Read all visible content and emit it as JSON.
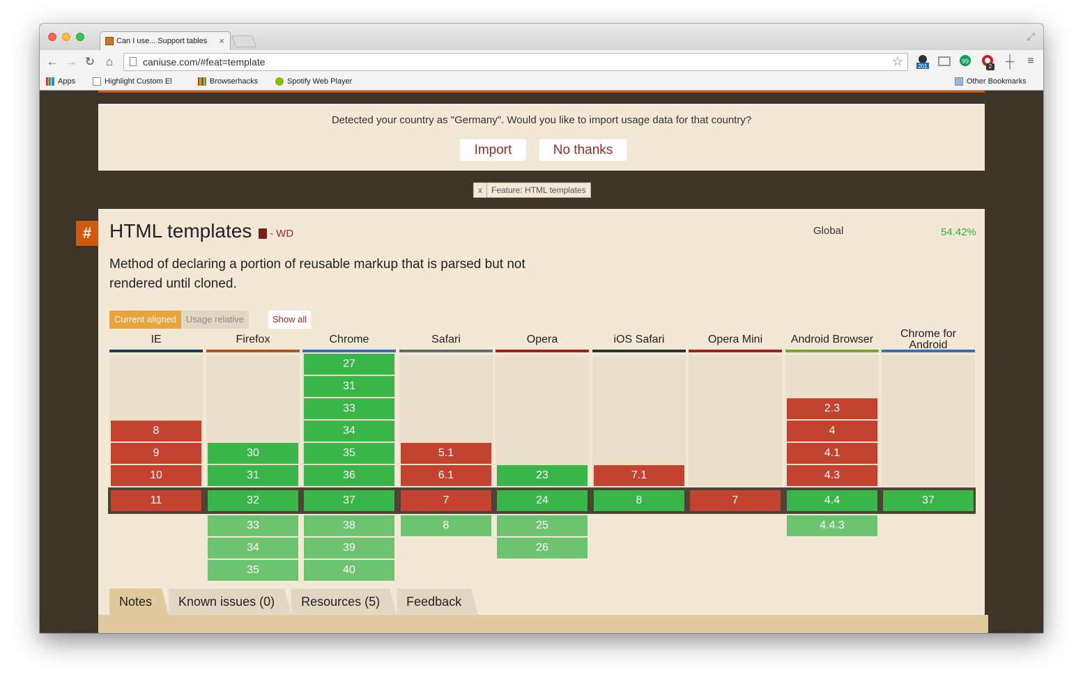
{
  "browser": {
    "tab_title": "Can I use... Support tables",
    "tab_close": "×",
    "url": "caniuse.com/#feat=template",
    "extensions": {
      "badge_1": "201",
      "badge_2": "2"
    },
    "bookmarks": [
      {
        "label": "Apps",
        "icon": "apps-grid-icon"
      },
      {
        "label": "Highlight Custom El",
        "icon": "page-icon"
      },
      {
        "label": "Browserhacks",
        "icon": "browserhacks-icon"
      },
      {
        "label": "Spotify Web Player",
        "icon": "spotify-icon"
      }
    ],
    "other_bookmarks": "Other Bookmarks"
  },
  "import_prompt": {
    "message": "Detected your country as \"Germany\". Would you like to import usage data for that country?",
    "import_label": "Import",
    "no_thanks_label": "No thanks"
  },
  "feature_chip": {
    "close": "x",
    "label": "Feature: HTML templates"
  },
  "feature": {
    "hash": "#",
    "title": "HTML templates",
    "status": "- WD",
    "global_label": "Global",
    "global_pct": "54.42%",
    "description": "Method of declaring a portion of reusable markup that is parsed but not rendered until cloned."
  },
  "view": {
    "current_aligned": "Current aligned",
    "usage_relative": "Usage relative",
    "show_all": "Show all"
  },
  "colors": {
    "no": "#c44230",
    "yes": "#39b54a",
    "future": "#6cc46f",
    "accent": "#d2580e"
  },
  "browsers": [
    {
      "name": "IE",
      "line": "#1f3a5f",
      "past": [
        {
          "v": "8",
          "s": "no"
        },
        {
          "v": "9",
          "s": "no"
        },
        {
          "v": "10",
          "s": "no"
        }
      ],
      "current": {
        "v": "11",
        "s": "no"
      },
      "future": []
    },
    {
      "name": "Firefox",
      "line": "#b5581f",
      "past": [
        {
          "v": "30",
          "s": "yes"
        },
        {
          "v": "31",
          "s": "yes"
        }
      ],
      "current": {
        "v": "32",
        "s": "yes"
      },
      "future": [
        "33",
        "34",
        "35"
      ]
    },
    {
      "name": "Chrome",
      "line": "#3a6fb5",
      "past": [
        {
          "v": "27",
          "s": "yes"
        },
        {
          "v": "31",
          "s": "yes"
        },
        {
          "v": "33",
          "s": "yes"
        },
        {
          "v": "34",
          "s": "yes"
        },
        {
          "v": "35",
          "s": "yes"
        },
        {
          "v": "36",
          "s": "yes"
        }
      ],
      "current": {
        "v": "37",
        "s": "yes"
      },
      "future": [
        "38",
        "39",
        "40"
      ]
    },
    {
      "name": "Safari",
      "line": "#6b6b6b",
      "past": [
        {
          "v": "5.1",
          "s": "no"
        },
        {
          "v": "6.1",
          "s": "no"
        }
      ],
      "current": {
        "v": "7",
        "s": "no"
      },
      "future": [
        "8"
      ]
    },
    {
      "name": "Opera",
      "line": "#a02020",
      "past": [
        {
          "v": "23",
          "s": "yes"
        }
      ],
      "current": {
        "v": "24",
        "s": "yes"
      },
      "future": [
        "25",
        "26"
      ]
    },
    {
      "name": "iOS Safari",
      "line": "#333333",
      "past": [
        {
          "v": "7.1",
          "s": "no"
        }
      ],
      "current": {
        "v": "8",
        "s": "yes"
      },
      "future": []
    },
    {
      "name": "Opera Mini",
      "line": "#a02020",
      "past": [],
      "current": {
        "v": "7",
        "s": "no"
      },
      "future": []
    },
    {
      "name": "Android Browser",
      "line": "#78a832",
      "past": [
        {
          "v": "2.3",
          "s": "no"
        },
        {
          "v": "4",
          "s": "no"
        },
        {
          "v": "4.1",
          "s": "no"
        },
        {
          "v": "4.3",
          "s": "no"
        }
      ],
      "current": {
        "v": "4.4",
        "s": "yes"
      },
      "future": [
        "4.4.3"
      ]
    },
    {
      "name": "Chrome for Android",
      "line": "#3a6fb5",
      "past": [],
      "current": {
        "v": "37",
        "s": "yes"
      },
      "future": []
    }
  ],
  "info_tabs": [
    "Notes",
    "Known issues (0)",
    "Resources (5)",
    "Feedback"
  ]
}
